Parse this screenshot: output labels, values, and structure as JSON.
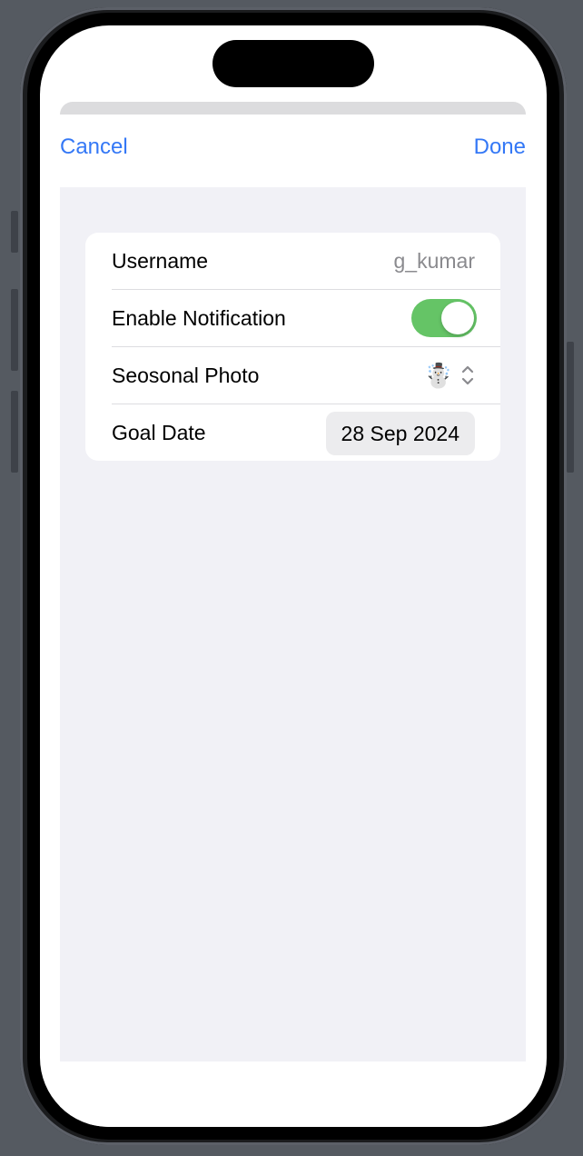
{
  "nav": {
    "cancel_label": "Cancel",
    "done_label": "Done"
  },
  "form": {
    "rows": [
      {
        "label": "Username",
        "value": "g_kumar"
      },
      {
        "label": "Enable Notification",
        "toggle_on": true
      },
      {
        "label": "Seosonal Photo",
        "selected_emoji": "☃️",
        "icon": "chevron-up-down-icon"
      },
      {
        "label": "Goal Date",
        "value": "28 Sep 2024"
      }
    ]
  },
  "colors": {
    "accent": "#3478f6",
    "toggle_on": "#65c466",
    "form_background": "#f1f1f6"
  }
}
